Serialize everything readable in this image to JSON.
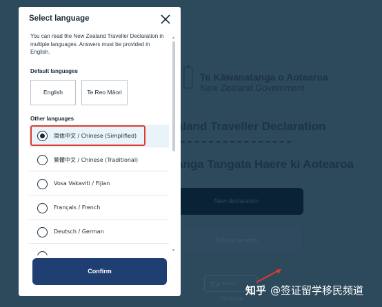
{
  "background": {
    "gov_name_mi": "Te Kāwanatanga o Aotearoa",
    "gov_name_en": "New Zealand Government",
    "title_en": "aland Traveller Declaration",
    "title_mi": "anga Tangata Haere ki Aotearoa",
    "new_button": "New declaration",
    "edit_button": "Edit declaration",
    "language_button": "Select language"
  },
  "modal": {
    "title": "Select language",
    "intro": "You can read the New Zealand Traveller Declaration in multiple languages. Answers must be provided in English.",
    "default_label": "Default languages",
    "default_languages": [
      "English",
      "Te Reo Māori"
    ],
    "other_label": "Other languages",
    "options": [
      {
        "label": "简体中文 / Chinese (Simplified)",
        "selected": true
      },
      {
        "label": "繁體中文 / Chinese (Traditional)",
        "selected": false
      },
      {
        "label": "Vosa Vakaviti / Fijian",
        "selected": false
      },
      {
        "label": "Français / French",
        "selected": false
      },
      {
        "label": "Deutsch / German",
        "selected": false
      }
    ],
    "confirm_label": "Confirm"
  },
  "watermark": {
    "brand": "知乎",
    "handle": "@签证留学移民频道"
  },
  "colors": {
    "backdrop": "#2c4a5c",
    "confirm": "#1f3f73",
    "highlight": "#e03b2d",
    "selected_row": "#e8f3fa"
  }
}
